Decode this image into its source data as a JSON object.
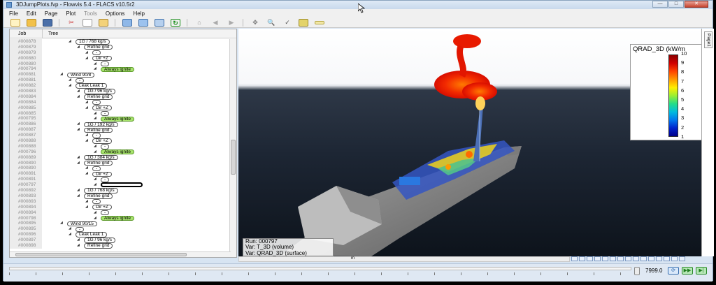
{
  "window": {
    "title": "3DJumpPlots.fvp - Flowvis 5.4 - FLACS v10.5r2"
  },
  "menu": [
    "File",
    "Edit",
    "Page",
    "Plot",
    "Tools",
    "Options",
    "Help"
  ],
  "menu_disabled": [
    "Tools"
  ],
  "tree": {
    "columns": {
      "job": "Job",
      "tree": "Tree"
    },
    "rows": [
      {
        "job": "#000878",
        "label": "1G / 768 kg/s",
        "indent": 3,
        "kind": "node"
      },
      {
        "job": "#000879",
        "label": "Refine grid",
        "indent": 4,
        "kind": "node"
      },
      {
        "job": "#000879",
        "label": "-",
        "indent": 5,
        "kind": "node"
      },
      {
        "job": "#000880",
        "label": "Dir +Z",
        "indent": 5,
        "kind": "node"
      },
      {
        "job": "#000880",
        "label": "-",
        "indent": 6,
        "kind": "node"
      },
      {
        "job": "#000794",
        "label": "Always ignite",
        "indent": 6,
        "kind": "green"
      },
      {
        "job": "#000881",
        "label": "Wind 90/8",
        "indent": 2,
        "kind": "node"
      },
      {
        "job": "#000881",
        "label": "-",
        "indent": 3,
        "kind": "node"
      },
      {
        "job": "#000882",
        "label": "Leak Leak 1",
        "indent": 3,
        "kind": "node"
      },
      {
        "job": "#000883",
        "label": "1G / 96 kg/s",
        "indent": 4,
        "kind": "node"
      },
      {
        "job": "#000884",
        "label": "Refine grid",
        "indent": 4,
        "kind": "node"
      },
      {
        "job": "#000884",
        "label": "-",
        "indent": 5,
        "kind": "node"
      },
      {
        "job": "#000885",
        "label": "Dir +Z",
        "indent": 5,
        "kind": "node"
      },
      {
        "job": "#000885",
        "label": "-",
        "indent": 6,
        "kind": "node"
      },
      {
        "job": "#000795",
        "label": "Always ignite",
        "indent": 6,
        "kind": "green"
      },
      {
        "job": "#000886",
        "label": "1G / 192 kg/s",
        "indent": 4,
        "kind": "node"
      },
      {
        "job": "#000887",
        "label": "Refine grid",
        "indent": 4,
        "kind": "node"
      },
      {
        "job": "#000887",
        "label": "-",
        "indent": 5,
        "kind": "node"
      },
      {
        "job": "#000888",
        "label": "Dir +Z",
        "indent": 5,
        "kind": "node"
      },
      {
        "job": "#000888",
        "label": "-",
        "indent": 6,
        "kind": "node"
      },
      {
        "job": "#000796",
        "label": "Always ignite",
        "indent": 6,
        "kind": "green"
      },
      {
        "job": "#000889",
        "label": "1G / 384 kg/s",
        "indent": 4,
        "kind": "node"
      },
      {
        "job": "#000890",
        "label": "Refine grid",
        "indent": 4,
        "kind": "node"
      },
      {
        "job": "#000890",
        "label": "-",
        "indent": 5,
        "kind": "node"
      },
      {
        "job": "#000891",
        "label": "Dir +Z",
        "indent": 5,
        "kind": "node"
      },
      {
        "job": "#000891",
        "label": "-",
        "indent": 6,
        "kind": "node"
      },
      {
        "job": "#000797",
        "label": "",
        "indent": 6,
        "kind": "empty"
      },
      {
        "job": "#000892",
        "label": "1G / 768 kg/s",
        "indent": 4,
        "kind": "node"
      },
      {
        "job": "#000893",
        "label": "Refine grid",
        "indent": 4,
        "kind": "node"
      },
      {
        "job": "#000893",
        "label": "-",
        "indent": 5,
        "kind": "node"
      },
      {
        "job": "#000894",
        "label": "Dir +Z",
        "indent": 5,
        "kind": "node"
      },
      {
        "job": "#000894",
        "label": "-",
        "indent": 6,
        "kind": "node"
      },
      {
        "job": "#000798",
        "label": "Always ignite",
        "indent": 6,
        "kind": "green"
      },
      {
        "job": "#000895",
        "label": "Wind 90/15",
        "indent": 2,
        "kind": "node"
      },
      {
        "job": "#000895",
        "label": "-",
        "indent": 3,
        "kind": "node"
      },
      {
        "job": "#000896",
        "label": "Leak Leak 1",
        "indent": 3,
        "kind": "node"
      },
      {
        "job": "#000897",
        "label": "1G / 96 kg/s",
        "indent": 4,
        "kind": "node"
      },
      {
        "job": "#000898",
        "label": "Refine grid",
        "indent": 4,
        "kind": "node"
      }
    ]
  },
  "legend": {
    "title": "QRAD_3D (kW/m",
    "ticks": [
      "10",
      "9",
      "8",
      "7",
      "6",
      "5",
      "4",
      "3",
      "2",
      "1"
    ],
    "colors": [
      "#8a0000",
      "#d10000",
      "#ff4400",
      "#ff9900",
      "#ffee00",
      "#99ee33",
      "#22dd88",
      "#00bbdd",
      "#0077ee",
      "#0022cc",
      "#00008a"
    ]
  },
  "run_info": {
    "run": "Run: 000797",
    "var1": "Var: T_3D (volume)",
    "var2": "Var: QRAD_3D (surface)"
  },
  "side_tab": "Page1",
  "scroll_marker": "m",
  "time_value": "7999.0",
  "playback_buttons": [
    "loop",
    "play",
    "step"
  ]
}
